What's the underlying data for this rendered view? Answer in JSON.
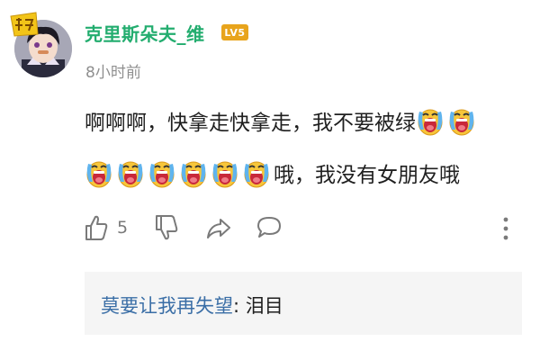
{
  "comment": {
    "username": "克里斯朵夫_维",
    "level_badge": "LV5",
    "timestamp": "8小时前",
    "line1_text": "啊啊啊，快拿走快拿走，我不要被绿",
    "line2_text": "哦，我没有女朋友哦",
    "emoji_name": "crying-emoji",
    "like_count": "5"
  },
  "reply": {
    "username": "莫要让我再失望",
    "separator": ":",
    "text": " 泪目"
  },
  "colors": {
    "username": "#23ad6f",
    "level_badge": "#e8a41c",
    "reply_user": "#3a6ea6",
    "reply_bg": "#f5f5f5"
  }
}
